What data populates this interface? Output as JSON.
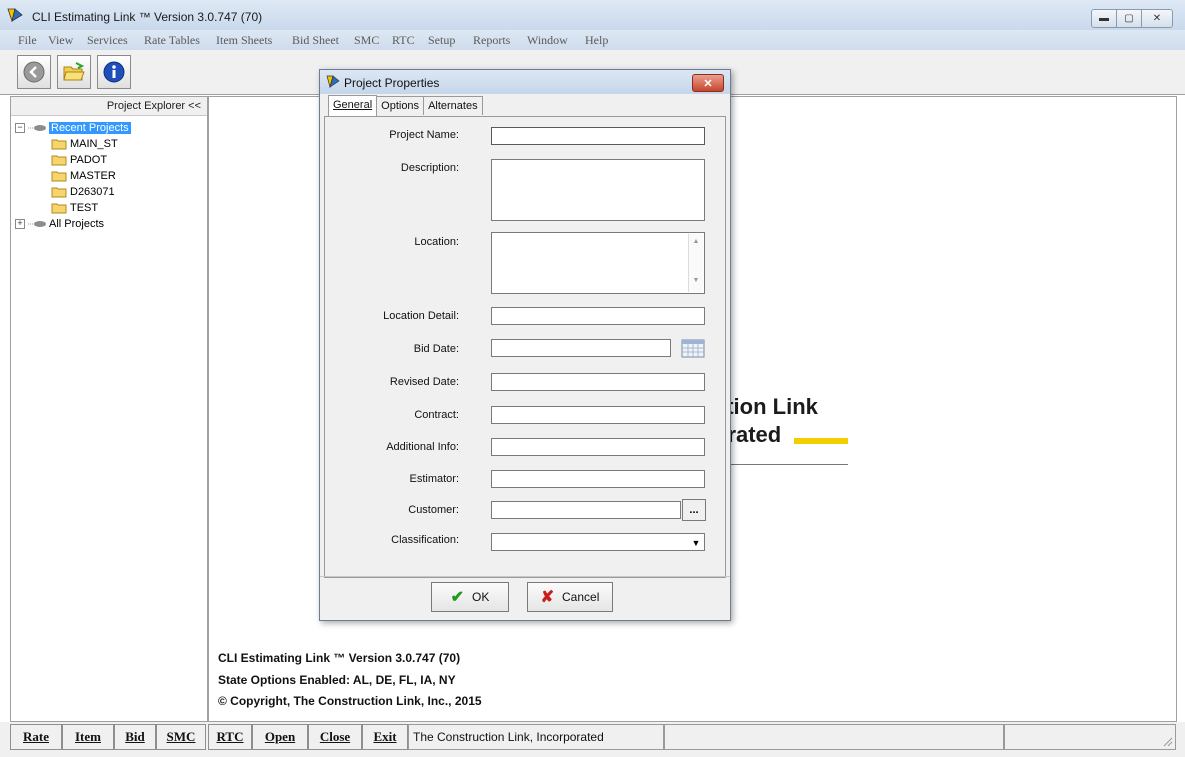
{
  "window": {
    "title": "CLI Estimating Link ™ Version  3.0.747 (70)",
    "minimize_icon": "minimize-icon",
    "maximize_icon": "maximize-icon",
    "close_icon": "close-icon"
  },
  "menu": [
    {
      "label": "File"
    },
    {
      "label": "View"
    },
    {
      "label": "Services"
    },
    {
      "label": "Rate Tables"
    },
    {
      "label": "Item Sheets"
    },
    {
      "label": "Bid Sheet"
    },
    {
      "label": "SMC"
    },
    {
      "label": "RTC"
    },
    {
      "label": "Setup"
    },
    {
      "label": "Reports"
    },
    {
      "label": "Window"
    },
    {
      "label": "Help"
    }
  ],
  "toolbar": {
    "buttons": [
      {
        "icon": "back-arrow-icon"
      },
      {
        "icon": "open-folder-icon"
      },
      {
        "icon": "info-icon"
      }
    ]
  },
  "explorer": {
    "header": "Project Explorer <<",
    "recent_label": "Recent Projects",
    "recent_items": [
      "MAIN_ST",
      "PADOT",
      "MASTER",
      "D263071",
      "TEST"
    ],
    "all_label": "All Projects"
  },
  "splash": {
    "line1": "ction Link",
    "line2": "orated",
    "accent_color": "#f2d000"
  },
  "info": {
    "version": "CLI Estimating Link ™ Version  3.0.747 (70)",
    "state_options": "State Options Enabled:  AL, DE, FL, IA, NY",
    "copyright": "© Copyright, The Construction Link, Inc., 2015"
  },
  "bottom": {
    "buttons": [
      "Rate",
      "Item",
      "Bid",
      "SMC",
      "RTC",
      "Open",
      "Close",
      "Exit"
    ],
    "status": "The Construction Link, Incorporated"
  },
  "dialog": {
    "title": "Project Properties",
    "tabs": [
      "General",
      "Options",
      "Alternates"
    ],
    "fields": {
      "project_name": {
        "label": "Project Name:",
        "value": ""
      },
      "description": {
        "label": "Description:",
        "value": ""
      },
      "location": {
        "label": "Location:",
        "value": ""
      },
      "location_detail": {
        "label": "Location Detail:",
        "value": ""
      },
      "bid_date": {
        "label": "Bid Date:",
        "value": ""
      },
      "revised_date": {
        "label": "Revised Date:",
        "value": ""
      },
      "contract": {
        "label": "Contract:",
        "value": ""
      },
      "additional_info": {
        "label": "Additional Info:",
        "value": ""
      },
      "estimator": {
        "label": "Estimator:",
        "value": ""
      },
      "customer": {
        "label": "Customer:",
        "value": ""
      },
      "classification": {
        "label": "Classification:",
        "value": ""
      }
    },
    "ellipsis": "...",
    "ok_label": "OK",
    "cancel_label": "Cancel",
    "ok_color": "#1e9a1e",
    "cancel_color": "#c81e1e"
  }
}
